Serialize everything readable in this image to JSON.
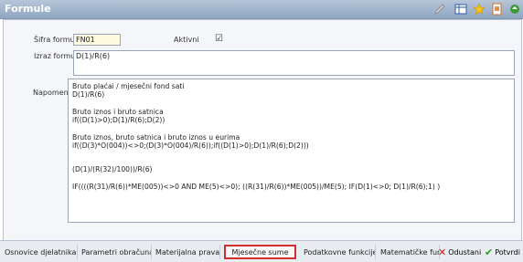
{
  "window": {
    "title": "Formule"
  },
  "toolbar": {
    "icons": [
      "edit-icon",
      "grid-icon",
      "star-icon",
      "document-icon",
      "refresh-icon"
    ]
  },
  "form": {
    "code_label": "Šifra formule",
    "code_value": "FN01",
    "active_label": "Aktivni",
    "active_checked": true,
    "active_mark": "☑",
    "expr_label": "Izraz formule",
    "expr_value": "D(1)/R(6)",
    "notes_label": "Napomene",
    "notes": {
      "l1": "Bruto plaćai / mjesečni fond sati",
      "l2": "D(1)/R(6)",
      "l3": "Bruto iznos i bruto satnica",
      "l4": "if((D(1)>0);D(1)/R(6);D(2))",
      "l5": "Bruto iznos, bruto satnica i bruto iznos u eurima",
      "l6": "if((D(3)*O(004))<>0;(D(3)*O(004)/R(6));if((D(1)>0);D(1)/R(6);D(2)))",
      "l7": "(D(1)/(R(32)/100))/R(6)",
      "l8": "IF((((R(31)/R(6))*ME(005))<>0 AND ME(5)<>0); ((R(31)/R(6))*ME(005))/ME(5); IF(D(1)<>0; D(1)/R(6);1) )"
    }
  },
  "tabs": [
    {
      "label": "Osnovice djelatnika"
    },
    {
      "label": "Parametri obračuna"
    },
    {
      "label": "Materijalna prava"
    },
    {
      "label": "Mjesečne sume"
    },
    {
      "label": "Podatkovne funkcije"
    },
    {
      "label": "Matematičke fun"
    }
  ],
  "actions": {
    "cancel_label": "Odustani",
    "confirm_label": "Potvrdi",
    "cancel_color": "#d02020",
    "confirm_color": "#2a9a2a"
  },
  "colors": {
    "titlebar": "#9eb2cb",
    "active_tab_border": "#d03030"
  }
}
